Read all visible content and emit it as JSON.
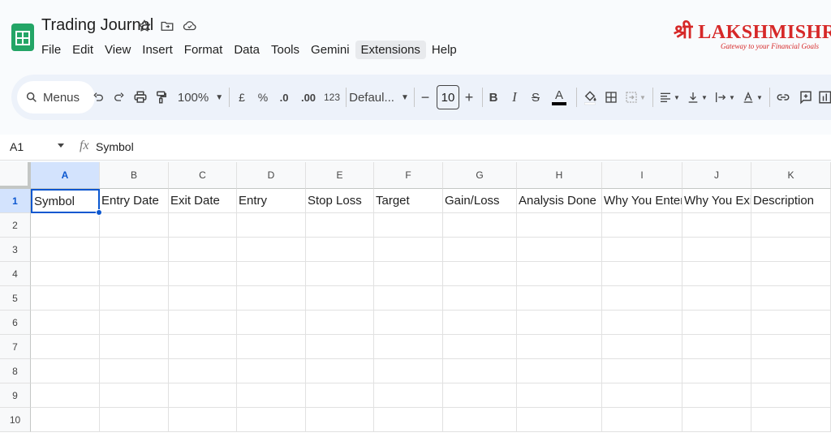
{
  "header": {
    "title": "Trading Journal",
    "menu": [
      "File",
      "Edit",
      "View",
      "Insert",
      "Format",
      "Data",
      "Tools",
      "Gemini",
      "Extensions",
      "Help"
    ],
    "active_menu": "Extensions"
  },
  "brand": {
    "name": "श्री LAKSHMISHREE",
    "tagline": "Gateway to your Financial Goals",
    "color": "#d62828"
  },
  "toolbar": {
    "search_label": "Menus",
    "zoom": "100%",
    "currency": "£",
    "percent": "%",
    "decrease_decimal": ".0",
    "increase_decimal": ".00",
    "number_format": "123",
    "font": "Defaul...",
    "font_size": "10",
    "bold": "B",
    "italic": "I",
    "strikethrough": "S",
    "text_color": "A",
    "text_color_bar": "#000000"
  },
  "formula_bar": {
    "cell_ref": "A1",
    "fx": "fx",
    "value": "Symbol"
  },
  "sheet": {
    "columns": [
      "A",
      "B",
      "C",
      "D",
      "E",
      "F",
      "G",
      "H",
      "I",
      "J",
      "K"
    ],
    "rows": [
      "1",
      "2",
      "3",
      "4",
      "5",
      "6",
      "7",
      "8",
      "9",
      "10"
    ],
    "header_row": [
      "Symbol",
      "Entry Date",
      "Exit Date",
      "Entry",
      "Stop Loss",
      "Target",
      "Gain/Loss",
      "Analysis Done",
      "Why You Entered",
      "Why You Exited",
      "Description"
    ],
    "selected_cell": "A1",
    "selection_color": "#0b57d0"
  }
}
